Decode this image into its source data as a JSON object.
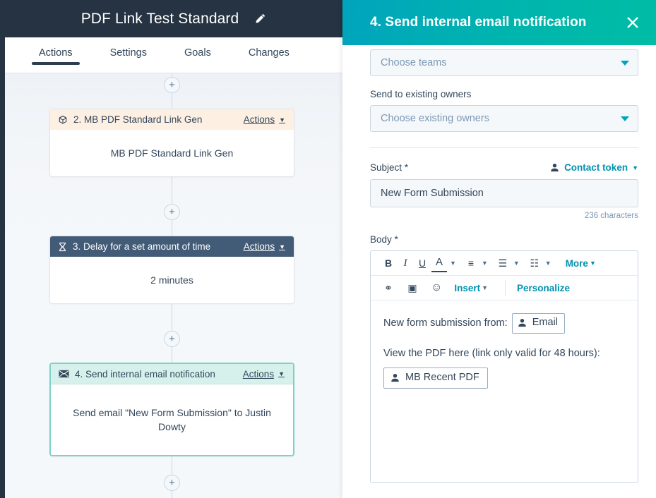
{
  "workflow": {
    "title": "PDF Link Test Standard",
    "edit_icon": "pencil-icon",
    "tabs": [
      {
        "label": "Actions",
        "active": true
      },
      {
        "label": "Settings",
        "active": false
      },
      {
        "label": "Goals",
        "active": false
      },
      {
        "label": "Changes",
        "active": false
      }
    ],
    "add_button_label": "+",
    "cards": [
      {
        "icon": "cube-icon",
        "header": "2. MB PDF Standard Link Gen",
        "actions_label": "Actions",
        "body": "MB PDF Standard Link Gen",
        "style": "orange"
      },
      {
        "icon": "hourglass-icon",
        "header": "3. Delay for a set amount of time",
        "actions_label": "Actions",
        "body": "2 minutes",
        "style": "dark"
      },
      {
        "icon": "envelope-icon",
        "header": "4. Send internal email notification",
        "actions_label": "Actions",
        "body": "Send email \"New Form Submission\" to Justin Dowty",
        "style": "teal-selected"
      }
    ]
  },
  "panel": {
    "title": "4. Send internal email notification",
    "close_icon": "close-icon",
    "accent_gradient_from": "#00a4bd",
    "accent_gradient_to": "#00bda5",
    "fields": {
      "teams_select_value": "Choose teams",
      "existing_owners_label": "Send to existing owners",
      "existing_owners_select_value": "Choose existing owners",
      "subject_label": "Subject *",
      "contact_token_label": "Contact token",
      "contact_token_icon": "person-icon",
      "subject_value": "New Form Submission",
      "char_count": "236 characters",
      "body_label": "Body *"
    },
    "editor": {
      "toolbar_row1": [
        {
          "name": "bold-icon",
          "glyph": "B"
        },
        {
          "name": "italic-icon",
          "glyph": "I"
        },
        {
          "name": "underline-icon",
          "glyph": "U"
        },
        {
          "name": "font-color-icon",
          "glyph": "A"
        },
        {
          "name": "align-icon",
          "glyph": "≡"
        },
        {
          "name": "bulleted-list-icon",
          "glyph": "☰"
        },
        {
          "name": "indent-icon",
          "glyph": "☷"
        }
      ],
      "more_label": "More",
      "toolbar_row2": [
        {
          "name": "link-icon",
          "glyph": "⚭"
        },
        {
          "name": "image-icon",
          "glyph": "▣"
        },
        {
          "name": "emoji-icon",
          "glyph": "☺"
        }
      ],
      "insert_label": "Insert",
      "personalize_label": "Personalize",
      "content": {
        "line1_text": "New form submission from:",
        "line1_token": "Email",
        "line1_token_icon": "person-icon",
        "line2_text": "View the PDF here (link only valid for 48 hours):",
        "line2_token": "MB Recent PDF",
        "line2_token_icon": "person-icon"
      }
    }
  }
}
